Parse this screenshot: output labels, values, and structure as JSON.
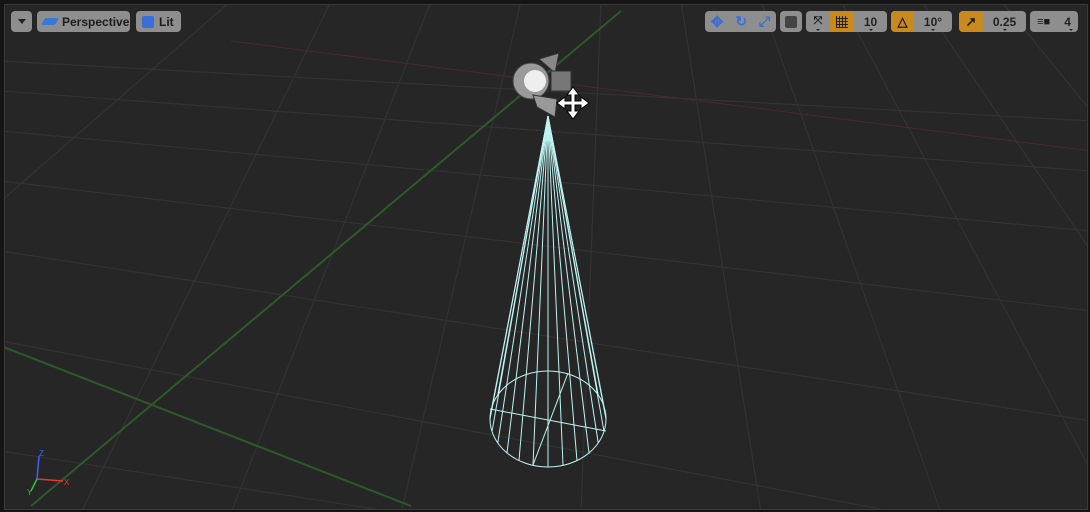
{
  "toolbar_left": {
    "menu_icon": "chevron-down-icon",
    "view_mode_label": "Perspective",
    "view_mode_icon": "perspective-icon",
    "lighting_label": "Lit",
    "lighting_icon": "lit-cube-icon"
  },
  "toolbar_right": {
    "transform_tools": [
      "translate-icon",
      "rotate-icon",
      "scale-icon"
    ],
    "coordinate_space_icon": "world-cube-icon",
    "surface_snapping_icon": "surface-snapping-icon",
    "grid_snap": {
      "enabled": true,
      "value": "10"
    },
    "rotation_snap": {
      "enabled": true,
      "value": "10°"
    },
    "scale_snap": {
      "enabled": true,
      "value": "0.25"
    },
    "camera_speed": {
      "value": "4"
    }
  },
  "colors": {
    "accent": "#c88a1e",
    "button": "#8e8e8e",
    "background": "#262626",
    "cone": "#bff4f4"
  },
  "scene": {
    "actor": "spot-light",
    "gizmo": "axis-indicator"
  }
}
